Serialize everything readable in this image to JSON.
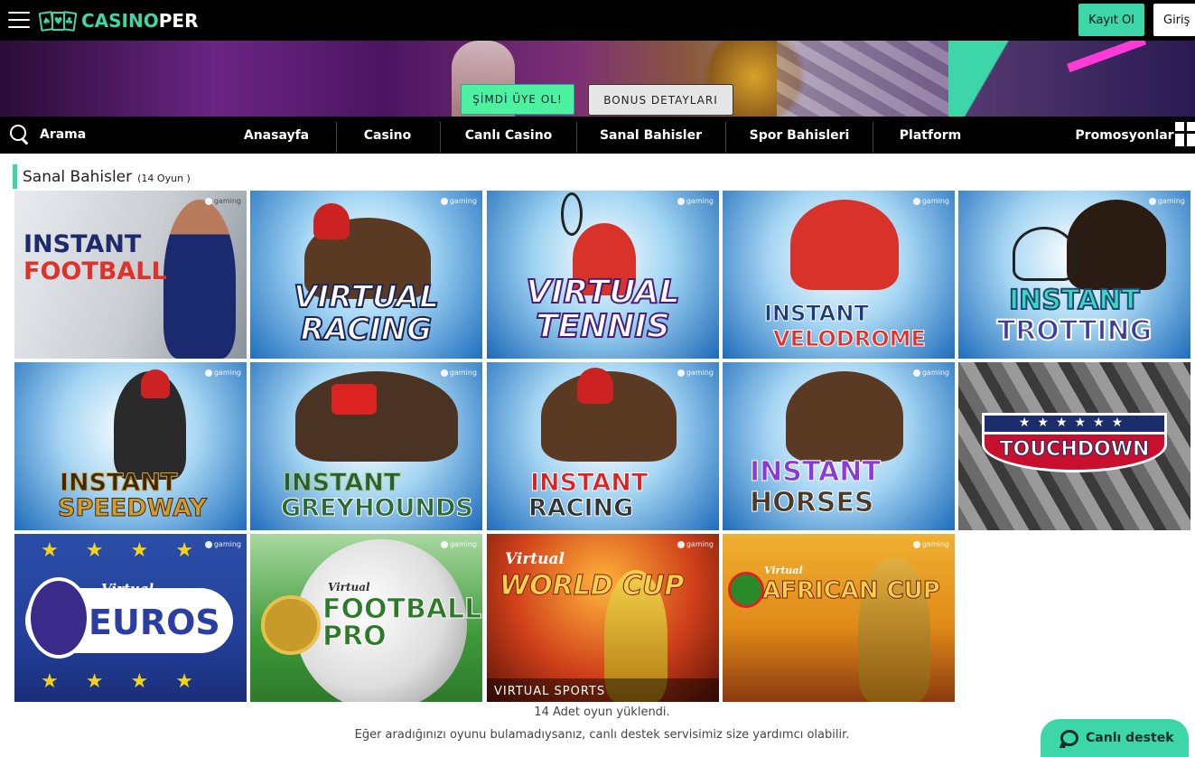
{
  "header": {
    "logo": {
      "part1": "CASINO",
      "part2": "PER"
    },
    "register_label": "Kayıt Ol",
    "login_label": "Giriş"
  },
  "banner": {
    "signup_label": "ŞİMDİ ÜYE OL!",
    "bonus_label": "BONUS DETAYLARI",
    "slide_count": 5,
    "active_slide": 4
  },
  "nav": {
    "search_label": "Arama",
    "items": [
      "Anasayfa",
      "Casino",
      "Canlı Casino",
      "Sanal Bahisler",
      "Spor Bahisleri",
      "Platform",
      "Promosyonlar"
    ]
  },
  "section": {
    "title": "Sanal Bahisler",
    "count": "(14 Oyun )"
  },
  "games": [
    {
      "line1": "INSTANT",
      "line2": "FOOTBALL",
      "badge": "gaming"
    },
    {
      "line1": "VIRTUAL",
      "line2": "RACING",
      "badge": "gaming"
    },
    {
      "line1": "VIRTUAL",
      "line2": "TENNIS",
      "badge": "gaming"
    },
    {
      "line1": "INSTANT",
      "line2": "VELODROME",
      "badge": "gaming"
    },
    {
      "line1": "INSTANT",
      "line2": "TROTTING",
      "badge": "gaming"
    },
    {
      "line1": "INSTANT",
      "line2": "SPEEDWAY",
      "badge": "gaming"
    },
    {
      "line1": "INSTANT",
      "line2": "GREYHOUNDS",
      "badge": "gaming"
    },
    {
      "line1": "INSTANT",
      "line2": "RACING",
      "badge": "gaming"
    },
    {
      "line1": "INSTANT",
      "line2": "HORSES",
      "badge": "gaming"
    },
    {
      "line1": "TOUCHDOWN",
      "line2": "",
      "badge": ""
    },
    {
      "small": "Virtual",
      "line1": "EUROS",
      "line2": "",
      "badge": "gaming"
    },
    {
      "small": "Virtual",
      "line1": "FOOTBALL",
      "line2": "PRO",
      "badge": "gaming"
    },
    {
      "small": "Virtual",
      "line1": "WORLD CUP",
      "line2": "VIRTUAL SPORTS",
      "badge": "gaming"
    },
    {
      "small": "Virtual",
      "line1": "AFRICAN CUP",
      "line2": "",
      "badge": "gaming"
    }
  ],
  "footer": {
    "loaded_text": "14 Adet oyun yüklendi.",
    "help_text": "Eğer aradığınızı oyunu bulamadıysanız, canlı destek servisimiz size yardımcı olabilir."
  },
  "chat": {
    "label": "Canlı destek"
  },
  "colors": {
    "accent": "#3dd6a8",
    "nav_bg": "#000000",
    "signup_btn": "#4cf2a0"
  }
}
